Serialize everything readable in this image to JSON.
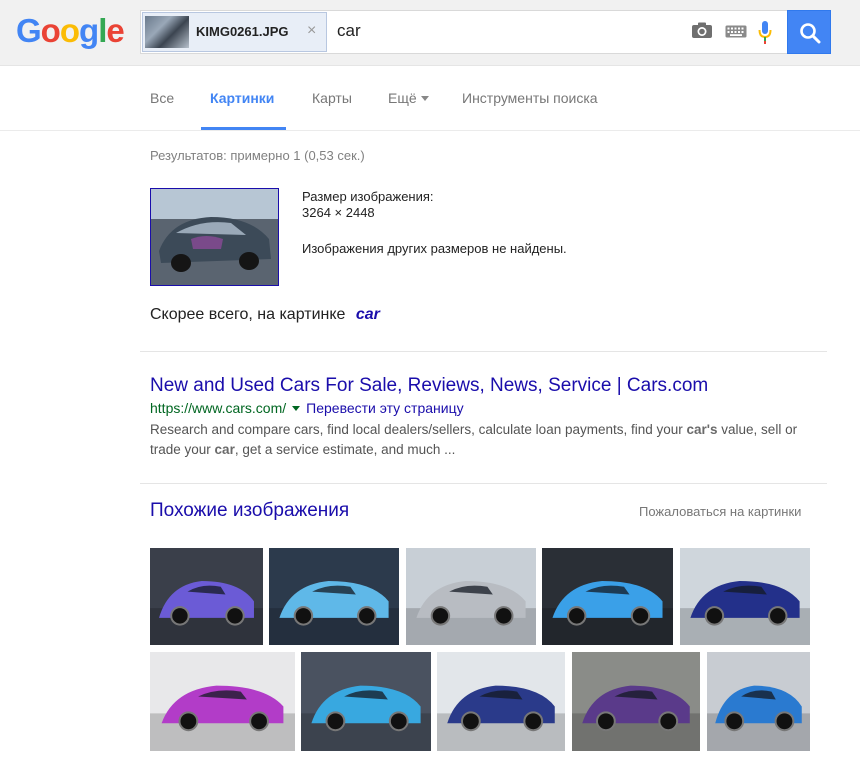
{
  "header": {
    "logo_letters": [
      {
        "char": "G",
        "color": "#4285f4"
      },
      {
        "char": "o",
        "color": "#ea4335"
      },
      {
        "char": "o",
        "color": "#fbbc05"
      },
      {
        "char": "g",
        "color": "#4285f4"
      },
      {
        "char": "l",
        "color": "#34a853"
      },
      {
        "char": "e",
        "color": "#ea4335"
      }
    ],
    "image_chip_name": "KIMG0261.JPG",
    "chip_close": "×",
    "query": "car",
    "icons": [
      "camera-icon",
      "keyboard-icon",
      "microphone-icon",
      "search-icon"
    ]
  },
  "tabs": {
    "all": "Все",
    "images": "Картинки",
    "maps": "Карты",
    "more": "Ещё",
    "tools": "Инструменты поиска"
  },
  "results": {
    "stats": "Результатов: примерно 1 (0,53 сек.)",
    "image_size_label": "Размер изображения:",
    "image_size_value": "3264 × 2448",
    "no_other_sizes": "Изображения других размеров не найдены.",
    "best_guess_prefix": "Скорее всего, на картинке",
    "best_guess_term": "car"
  },
  "result": {
    "title": "New and Used Cars For Sale, Reviews, News, Service | Cars.com",
    "url": "https://www.cars.com/",
    "translate": "Перевести эту страницу",
    "snippet_1": "Research and compare cars, find local dealers/sellers, calculate loan payments, find your ",
    "snippet_b1": "car's",
    "snippet_2": " value, sell or trade your ",
    "snippet_b2": "car",
    "snippet_3": ", get a service estimate, and much ..."
  },
  "similar": {
    "title": "Похожие изображения",
    "report": "Пожаловаться на картинки",
    "tiles": [
      {
        "bg": "#3a3f4a",
        "car": "#6b5bd6"
      },
      {
        "bg": "#2c3a4c",
        "car": "#5fb8e8"
      },
      {
        "bg": "#c8cfd6",
        "car": "#b8bcc2"
      },
      {
        "bg": "#2a2f36",
        "car": "#3aa0e8"
      },
      {
        "bg": "#cfd6dc",
        "car": "#23308a"
      },
      {
        "bg": "#e8e8ea",
        "car": "#b23cc8"
      },
      {
        "bg": "#4a5260",
        "car": "#38a8e0"
      },
      {
        "bg": "#e2e6ea",
        "car": "#2a3a8a"
      },
      {
        "bg": "#8a8c88",
        "car": "#5a3a8a"
      },
      {
        "bg": "#c8ccd2",
        "car": "#2a7ad0"
      }
    ]
  }
}
